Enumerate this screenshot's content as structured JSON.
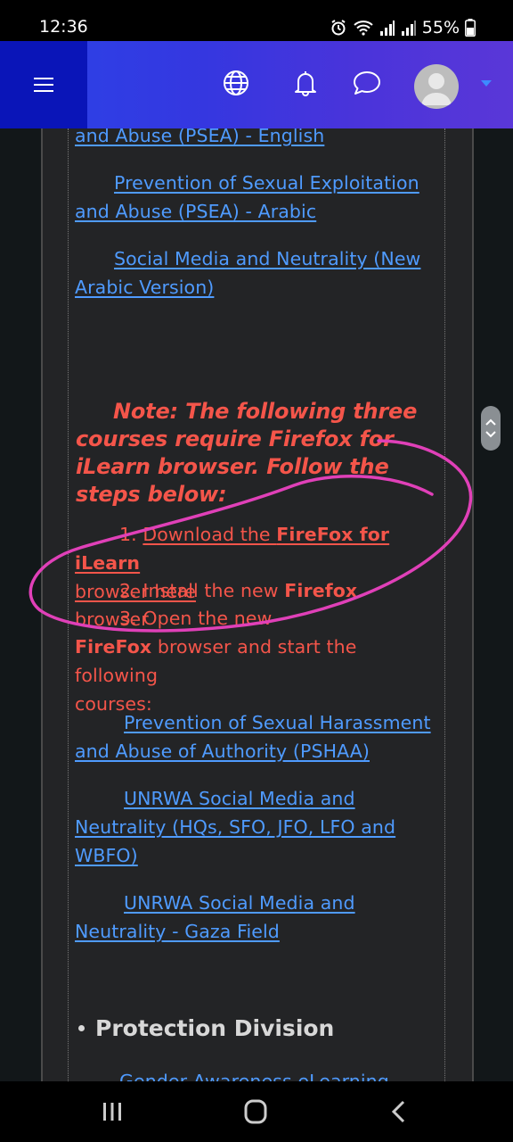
{
  "status_bar": {
    "time": "12:36",
    "battery": "55%"
  },
  "header": {
    "icons": [
      "menu-icon",
      "globe-icon",
      "bell-icon",
      "chat-icon",
      "avatar",
      "caret-down-icon"
    ]
  },
  "content": {
    "links_top": [
      "and Abuse (PSEA) - English",
      "Prevention of Sexual Exploitation",
      "and Abuse (PSEA) - Arabic",
      "Social Media and Neutrality (New",
      "Arabic Version)"
    ],
    "note": {
      "line1": "Note: The following three",
      "line2": "courses require Firefox for",
      "line3": "iLearn browser. Follow the",
      "line4": "steps below:"
    },
    "steps": {
      "s1_num": "1.",
      "s1_a": "Download the ",
      "s1_b": "FireFox for iLearn",
      "s1_c": "browser here",
      "s2_a": "2. Install the new ",
      "s2_b": "Firefox",
      "s2_c": " browser",
      "s3_a": "3. Open the new",
      "s3_b": "FireFox",
      "s3_c": " browser and start the following",
      "s3_d": "courses:"
    },
    "links_bottom": [
      "Prevention of Sexual Harassment",
      "and Abuse of Authority (PSHAA)",
      "UNRWA Social Media and",
      "Neutrality (HQs, SFO, JFO, LFO and",
      "WBFO)",
      "UNRWA Social Media and",
      "Neutrality - Gaza Field"
    ],
    "section_heading": "Protection Division",
    "next_link": "Gender Awareness eLearning"
  },
  "colors": {
    "link": "#4f9bff",
    "note_red": "#f4554a",
    "annotation_pink": "#e040b8",
    "header_start": "#2a44e8",
    "header_end": "#5a37d8",
    "menu_block": "#0a15b8"
  }
}
